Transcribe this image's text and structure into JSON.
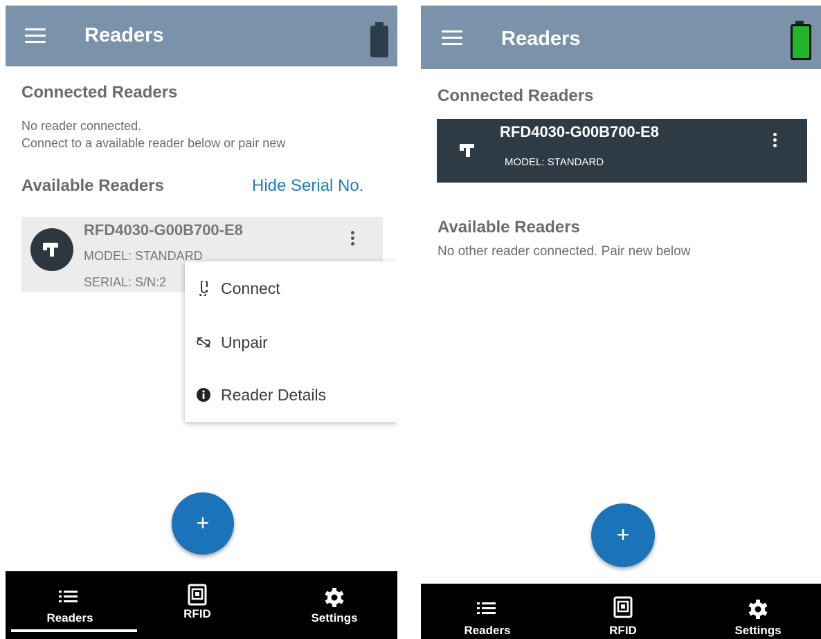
{
  "left_screen": {
    "app_title": "Readers",
    "connected_section": {
      "title": "Connected Readers",
      "empty_line1": "No reader connected.",
      "empty_line2": "Connect to a available reader below or pair new"
    },
    "available_section": {
      "title": "Available Readers",
      "hide_serial_link": "Hide Serial No."
    },
    "reader": {
      "name": "RFD4030-G00B700-E8",
      "model": "MODEL: STANDARD",
      "serial": "SERIAL: S/N:2"
    },
    "context_menu": [
      {
        "label": "Connect",
        "icon": "link-icon"
      },
      {
        "label": "Unpair",
        "icon": "unlink-icon"
      },
      {
        "label": "Reader Details",
        "icon": "info-icon"
      }
    ],
    "fab_label": "+",
    "bottom_nav": [
      {
        "label": "Readers",
        "icon": "list-icon",
        "selected": true
      },
      {
        "label": "RFID",
        "icon": "rfid-icon",
        "selected": false
      },
      {
        "label": "Settings",
        "icon": "gear-icon",
        "selected": false
      }
    ],
    "battery_color": "#2c3e4c"
  },
  "right_screen": {
    "app_title": "Readers",
    "connected_section": {
      "title": "Connected Readers"
    },
    "connected_reader": {
      "name": "RFD4030-G00B700-E8",
      "model": "MODEL: STANDARD"
    },
    "available_section": {
      "title": "Available Readers",
      "empty_text": "No other reader connected. Pair new below"
    },
    "fab_label": "+",
    "bottom_nav": [
      {
        "label": "Readers",
        "icon": "list-icon"
      },
      {
        "label": "RFID",
        "icon": "rfid-icon"
      },
      {
        "label": "Settings",
        "icon": "gear-icon"
      }
    ],
    "battery_color": "#22b52a"
  },
  "colors": {
    "appbar": "#7a93aa",
    "accent": "#1a74ba",
    "link": "#1a7ec2",
    "connected_card": "#2e3a44"
  }
}
